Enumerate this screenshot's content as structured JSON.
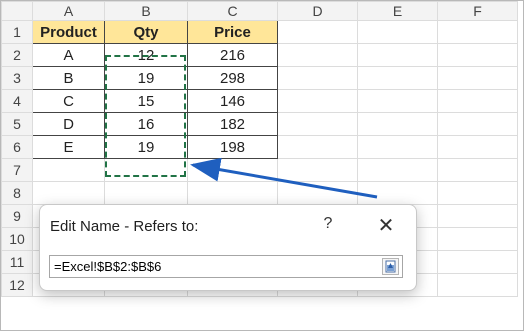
{
  "columns": [
    "A",
    "B",
    "C",
    "D",
    "E",
    "F"
  ],
  "rows": [
    "1",
    "2",
    "3",
    "4",
    "5",
    "6",
    "7",
    "8",
    "9",
    "10",
    "11",
    "12"
  ],
  "table": {
    "headers": [
      "Product",
      "Qty",
      "Price"
    ],
    "data": [
      [
        "A",
        "12",
        "216"
      ],
      [
        "B",
        "19",
        "298"
      ],
      [
        "C",
        "15",
        "146"
      ],
      [
        "D",
        "16",
        "182"
      ],
      [
        "E",
        "19",
        "198"
      ]
    ]
  },
  "dialog": {
    "title": "Edit Name - Refers to:",
    "help": "?",
    "close": "✕",
    "value": "=Excel!$B$2:$B$6",
    "collapse_icon": "collapse-range-icon"
  },
  "colors": {
    "header_fill": "#ffe699",
    "marching_ants": "#217346",
    "arrow": "#1f5fbf"
  }
}
